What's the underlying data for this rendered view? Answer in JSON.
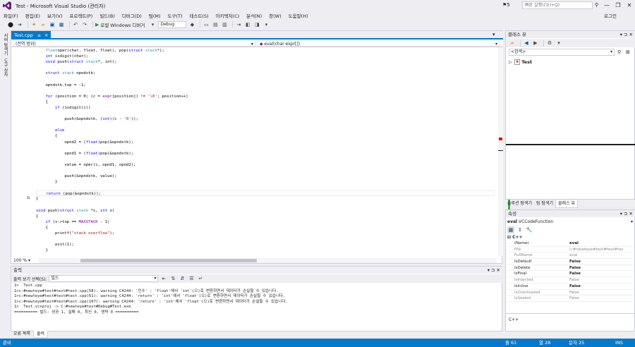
{
  "window": {
    "title": "Test - Microsoft Visual Studio (관리자)",
    "notifications": "5",
    "quick_launch_placeholder": "빠른 실행(Ctrl+Q)",
    "login": "로그인",
    "minimize": "—",
    "restore": "❐",
    "close": "✕"
  },
  "menu": [
    "파일(F)",
    "편집(E)",
    "보기(V)",
    "프로젝트(P)",
    "빌드(B)",
    "디버그(D)",
    "팀(M)",
    "도구(T)",
    "테스트(S)",
    "아키텍처(C)",
    "분석(N)",
    "창(W)",
    "도움말(H)"
  ],
  "toolbar": {
    "run_label": "로컬 Windows 디버거",
    "config": "Debug"
  },
  "left_strip": [
    "서버 탐색기",
    "도구 상자"
  ],
  "editor": {
    "tab_name": "Test.cpp",
    "tab_pin": "ㅍ",
    "tab_close": "✕",
    "nav_scope": "(전역 범위)",
    "nav_member": "eval(char expr[])",
    "zoom": "100 %"
  },
  "code": [
    {
      "indent": "    ",
      "parts": [
        [
          "ty",
          "float"
        ],
        [
          "",
          "oper(char, float, float), pop("
        ],
        [
          "kw",
          "struct"
        ],
        [
          "",
          " "
        ],
        [
          "ty",
          "stack"
        ],
        [
          "",
          "*);"
        ]
      ]
    },
    {
      "indent": "    ",
      "parts": [
        [
          "kw",
          "int"
        ],
        [
          "",
          " isdigit(char);"
        ]
      ]
    },
    {
      "indent": "    ",
      "parts": [
        [
          "kw",
          "void"
        ],
        [
          "",
          " push("
        ],
        [
          "kw",
          "struct"
        ],
        [
          "",
          " "
        ],
        [
          "ty",
          "stack"
        ],
        [
          "",
          "*, int);"
        ]
      ]
    },
    {
      "indent": "",
      "parts": []
    },
    {
      "indent": "    ",
      "parts": [
        [
          "kw",
          "struct"
        ],
        [
          "",
          " "
        ],
        [
          "ty",
          "stack"
        ],
        [
          "",
          " opndstk;"
        ]
      ]
    },
    {
      "indent": "",
      "parts": []
    },
    {
      "indent": "    ",
      "parts": [
        [
          "",
          "opndstk.top = -1;"
        ]
      ]
    },
    {
      "indent": "",
      "parts": []
    },
    {
      "indent": "    ",
      "parts": [
        [
          "kw",
          "for"
        ],
        [
          "",
          " (position = 0; (c = "
        ],
        [
          "mac",
          "expr"
        ],
        [
          "",
          "[position]) != "
        ],
        [
          "str",
          "'\\0'"
        ],
        [
          "",
          "; position++)"
        ]
      ]
    },
    {
      "indent": "    ",
      "parts": [
        [
          "",
          "{"
        ]
      ]
    },
    {
      "indent": "        ",
      "parts": [
        [
          "kw",
          "if"
        ],
        [
          "",
          " (isdigit(c))"
        ]
      ]
    },
    {
      "indent": "",
      "parts": []
    },
    {
      "indent": "            ",
      "parts": [
        [
          "",
          "push(&opndstk, ("
        ],
        [
          "kw",
          "int"
        ],
        [
          "",
          ")(c - "
        ],
        [
          "str",
          "'0'"
        ],
        [
          "",
          "));"
        ]
      ]
    },
    {
      "indent": "",
      "parts": []
    },
    {
      "indent": "        ",
      "parts": [
        [
          "kw",
          "else"
        ]
      ]
    },
    {
      "indent": "        ",
      "parts": [
        [
          "",
          "{"
        ]
      ]
    },
    {
      "indent": "            ",
      "parts": [
        [
          "",
          "opnd2 = ("
        ],
        [
          "kw",
          "float"
        ],
        [
          "",
          ")pop(&opndstk);"
        ]
      ]
    },
    {
      "indent": "",
      "parts": []
    },
    {
      "indent": "            ",
      "parts": [
        [
          "",
          "opnd1 = ("
        ],
        [
          "kw",
          "float"
        ],
        [
          "",
          ")pop(&opndstk);"
        ]
      ]
    },
    {
      "indent": "",
      "parts": []
    },
    {
      "indent": "            ",
      "parts": [
        [
          "",
          "value = oper(c, opnd1, opnd2);"
        ]
      ]
    },
    {
      "indent": "",
      "parts": []
    },
    {
      "indent": "            ",
      "parts": [
        [
          "",
          "push(&opndstk, value);"
        ]
      ]
    },
    {
      "indent": "        ",
      "parts": [
        [
          "",
          "}"
        ]
      ]
    },
    {
      "indent": "",
      "parts": []
    },
    {
      "indent": "    ",
      "parts": [
        [
          "kw",
          "return"
        ],
        [
          "",
          " (pop(&opndstk));"
        ]
      ]
    },
    {
      "indent": "",
      "parts": [
        [
          "",
          "}"
        ]
      ]
    },
    {
      "indent": "",
      "parts": []
    },
    {
      "indent": "",
      "parts": [
        [
          "kw",
          "void"
        ],
        [
          "",
          " push("
        ],
        [
          "kw",
          "struct"
        ],
        [
          "",
          " "
        ],
        [
          "ty",
          "stack"
        ],
        [
          "",
          " *s, "
        ],
        [
          "kw",
          "int"
        ],
        [
          "",
          " x)"
        ]
      ]
    },
    {
      "indent": "",
      "parts": [
        [
          "",
          "{"
        ]
      ]
    },
    {
      "indent": "    ",
      "parts": [
        [
          "kw",
          "if"
        ],
        [
          "",
          " (s->top == "
        ],
        [
          "mac",
          "MAXSTACK"
        ],
        [
          "",
          " - 1)"
        ]
      ]
    },
    {
      "indent": "    ",
      "parts": [
        [
          "",
          "{"
        ]
      ]
    },
    {
      "indent": "        ",
      "parts": [
        [
          "",
          "printf("
        ],
        [
          "str",
          "\"stack overflow\""
        ],
        [
          "",
          ");"
        ]
      ]
    },
    {
      "indent": "",
      "parts": []
    },
    {
      "indent": "        ",
      "parts": [
        [
          "",
          "exit(1);"
        ]
      ]
    },
    {
      "indent": "    ",
      "parts": [
        [
          "",
          "}"
        ]
      ]
    }
  ],
  "output": {
    "title": "출력",
    "source_label": "출력 보기 선택(S):",
    "source_value": "빌드",
    "lines": [
      "1>  Test.cpp",
      "1>c:#newteye#test#test#test.cpp(58): warning C4244: '인수' : 'float'에서 'int'(으)로 변환하면서 데이터가 손실될 수 있습니다.",
      "1>c:#newteye#test#test#test.cpp(61): warning C4244: 'return' : 'int'에서 'float'(으)로 변환하면서 데이터가 손실될 수 있습니다.",
      "1>c:#newteye#test#test#test.cpp(107): warning C4244: 'return' : 'int'에서 'float'(으)로 변환하면서 데이터가 손실될 수 있습니다.",
      "1>  Test.vcxproj -> C:#newteye#test#Debug#Test.exe",
      "========== 빌드: 성공 1, 실패 0, 최신 0, 생략 0 =========="
    ],
    "tabs": [
      "오류 목록",
      "출력"
    ]
  },
  "classview": {
    "title": "클래스 뷰",
    "search_placeholder": "<검색>",
    "tree_root": "Test",
    "tabs": [
      "솔루션 탐색기",
      "팀 탐색기",
      "클래스 뷰"
    ]
  },
  "properties": {
    "title": "속성",
    "object_name": "eval",
    "object_type": "VCCodeFunction",
    "category": "C++",
    "rows": [
      {
        "name": "(Name)",
        "value": "eval",
        "dim": false,
        "bold": true
      },
      {
        "name": "File",
        "value": "c:#newteye#test#test#tes",
        "dim": true,
        "bold": false
      },
      {
        "name": "FullName",
        "value": "eval",
        "dim": true,
        "bold": false
      },
      {
        "name": "IsDefault",
        "value": "False",
        "dim": false,
        "bold": true
      },
      {
        "name": "IsDelete",
        "value": "False",
        "dim": false,
        "bold": true
      },
      {
        "name": "IsFinal",
        "value": "False",
        "dim": false,
        "bold": true
      },
      {
        "name": "IsInjected",
        "value": "False",
        "dim": true,
        "bold": false
      },
      {
        "name": "IsInline",
        "value": "False",
        "dim": false,
        "bold": true
      },
      {
        "name": "IsOverloaded",
        "value": "False",
        "dim": true,
        "bold": false
      },
      {
        "name": "IsSealed",
        "value": "False",
        "dim": true,
        "bold": false
      }
    ],
    "description": "C++"
  },
  "status": {
    "ready": "준비",
    "line": "줄 61",
    "col": "열 28",
    "ch": "문자 25",
    "mode": "INS"
  },
  "colors": {
    "accent": "#007acc",
    "change_bar": "#39b54a",
    "error_marker": "#e51400"
  }
}
